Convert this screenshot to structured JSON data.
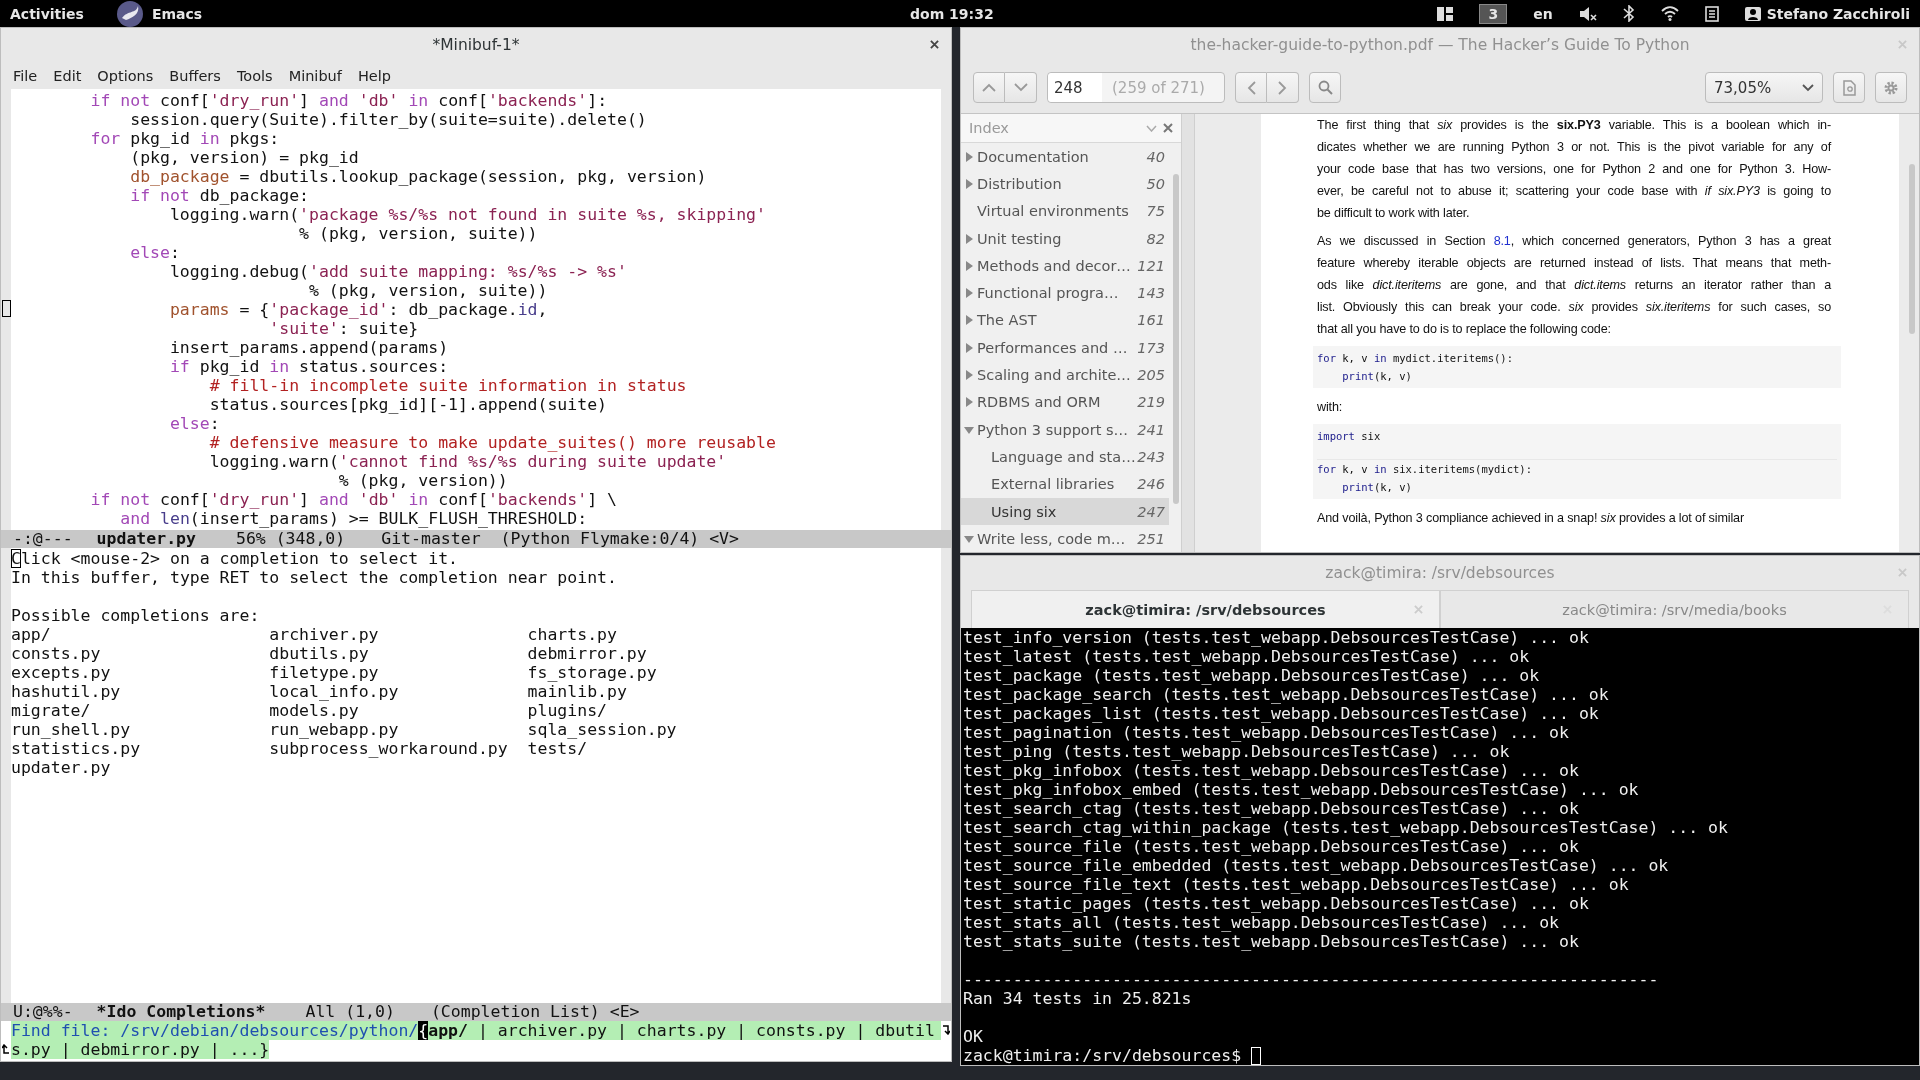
{
  "top_bar": {
    "activities": "Activities",
    "app": "Emacs",
    "clock": "dom 19:32",
    "workspace": "3",
    "keyboard": "en",
    "user": "Stefano Zacchiroli"
  },
  "emacs": {
    "title": "*Minibuf-1*",
    "menu": [
      "File",
      "Edit",
      "Options",
      "Buffers",
      "Tools",
      "Minibuf",
      "Help"
    ],
    "code_lines": [
      [
        {
          "kind": "keyword",
          "text": "        if not"
        },
        {
          "kind": "plain",
          "text": " conf["
        },
        {
          "kind": "string",
          "text": "'dry_run'"
        },
        {
          "kind": "plain",
          "text": "] "
        },
        {
          "kind": "keyword",
          "text": "and "
        },
        {
          "kind": "string",
          "text": "'db' "
        },
        {
          "kind": "keyword",
          "text": "in"
        },
        {
          "kind": "plain",
          "text": " conf["
        },
        {
          "kind": "string",
          "text": "'backends'"
        },
        {
          "kind": "plain",
          "text": "]:"
        }
      ],
      [
        {
          "kind": "plain",
          "text": "            session.query(Suite).filter_by(suite=suite).delete()"
        }
      ],
      [
        {
          "kind": "keyword",
          "text": "        for"
        },
        {
          "kind": "plain",
          "text": " pkg_id "
        },
        {
          "kind": "keyword",
          "text": "in"
        },
        {
          "kind": "plain",
          "text": " pkgs:"
        }
      ],
      [
        {
          "kind": "plain",
          "text": "            (pkg, version) = pkg_id"
        }
      ],
      [
        {
          "kind": "variable",
          "text": "            db_package"
        },
        {
          "kind": "plain",
          "text": " = dbutils.lookup_package(session, pkg, version)"
        }
      ],
      [
        {
          "kind": "keyword",
          "text": "            if not"
        },
        {
          "kind": "plain",
          "text": " db_package:"
        }
      ],
      [
        {
          "kind": "plain",
          "text": "                logging.warn("
        },
        {
          "kind": "string",
          "text": "'package %s/%s not found in suite %s, skipping'"
        }
      ],
      [
        {
          "kind": "plain",
          "text": "                             % (pkg, version, suite))"
        }
      ],
      [
        {
          "kind": "keyword",
          "text": "            else"
        },
        {
          "kind": "plain",
          "text": ":"
        }
      ],
      [
        {
          "kind": "plain",
          "text": "                logging.debug("
        },
        {
          "kind": "string",
          "text": "'add suite mapping: %s/%s -> %s'"
        }
      ],
      [
        {
          "kind": "plain",
          "text": "                              % (pkg, version, suite))"
        }
      ],
      [
        {
          "kind": "variable",
          "text": "                params"
        },
        {
          "kind": "plain",
          "text": " = {"
        },
        {
          "kind": "string",
          "text": "'package_id'"
        },
        {
          "kind": "plain",
          "text": ": db_package."
        },
        {
          "kind": "builtin",
          "text": "id"
        },
        {
          "kind": "plain",
          "text": ","
        }
      ],
      [
        {
          "kind": "string",
          "text": "                          'suite'"
        },
        {
          "kind": "plain",
          "text": ": suite}"
        }
      ],
      [
        {
          "kind": "plain",
          "text": "                insert_params.append(params)"
        }
      ],
      [
        {
          "kind": "keyword",
          "text": "                if"
        },
        {
          "kind": "plain",
          "text": " pkg_id "
        },
        {
          "kind": "keyword",
          "text": "in"
        },
        {
          "kind": "plain",
          "text": " status.sources:"
        }
      ],
      [
        {
          "kind": "comment",
          "text": "                    # fill-in incomplete suite information in status"
        }
      ],
      [
        {
          "kind": "plain",
          "text": "                    status.sources[pkg_id][-1].append(suite)"
        }
      ],
      [
        {
          "kind": "keyword",
          "text": "                else"
        },
        {
          "kind": "plain",
          "text": ":"
        }
      ],
      [
        {
          "kind": "comment",
          "text": "                    # defensive measure to make update_suites() more reusable"
        }
      ],
      [
        {
          "kind": "plain",
          "text": "                    logging.warn("
        },
        {
          "kind": "string",
          "text": "'cannot find %s/%s during suite update'"
        }
      ],
      [
        {
          "kind": "plain",
          "text": "                                 % (pkg, version))"
        }
      ],
      [
        {
          "kind": "keyword",
          "text": "        if not"
        },
        {
          "kind": "plain",
          "text": " conf["
        },
        {
          "kind": "string",
          "text": "'dry_run'"
        },
        {
          "kind": "plain",
          "text": "] "
        },
        {
          "kind": "keyword",
          "text": "and "
        },
        {
          "kind": "string",
          "text": "'db' "
        },
        {
          "kind": "keyword",
          "text": "in"
        },
        {
          "kind": "plain",
          "text": " conf["
        },
        {
          "kind": "string",
          "text": "'backends'"
        },
        {
          "kind": "plain",
          "text": "] \\"
        }
      ],
      [
        {
          "kind": "keyword",
          "text": "           and "
        },
        {
          "kind": "builtin",
          "text": "len"
        },
        {
          "kind": "plain",
          "text": "(insert_params) >= BULK_FLUSH_THRESHOLD:"
        }
      ]
    ],
    "mode_line": {
      "state": "-:@---",
      "buffer": "updater.py",
      "position": "56% (348,0)",
      "branch": "Git-master",
      "modes": "(Python Flymake:0/4) <V>"
    },
    "help_lines": [
      "Click <mouse-2> on a completion to select it.",
      "In this buffer, type RET to select the completion near point."
    ],
    "completions_heading": "Possible completions are:",
    "completions": [
      "app/",
      "archiver.py",
      "charts.py",
      "consts.py",
      "dbutils.py",
      "debmirror.py",
      "excepts.py",
      "filetype.py",
      "fs_storage.py",
      "hashutil.py",
      "local_info.py",
      "mainlib.py",
      "migrate/",
      "models.py",
      "plugins/",
      "run_shell.py",
      "run_webapp.py",
      "sqla_session.py",
      "statistics.py",
      "subprocess_workaround.py",
      "tests/",
      "updater.py"
    ],
    "completions_mode_line": {
      "state": "U:@%%-",
      "buffer": "*Ido Completions*",
      "position": "All (1,0)",
      "modes": "(Completion List) <E>"
    },
    "minibuffer": {
      "prompt": "Find file: /srv/debian/debsources/python/",
      "brace": "{",
      "current": "app/",
      "rest": " | archiver.py | charts.py | consts.py | dbutil",
      "continuation": "s.py | debmirror.py | ...}"
    }
  },
  "pdf_viewer": {
    "title": "the-hacker-guide-to-python.pdf — The Hacker’s Guide To Python",
    "page": "248",
    "page_info": "(259 of 271)",
    "zoom": "73,05%",
    "index_title": "Index",
    "index": [
      {
        "label": "Documentation",
        "page": "40",
        "expanded": false,
        "selected": false
      },
      {
        "label": "Distribution",
        "page": "50",
        "expanded": false,
        "selected": false
      },
      {
        "label": "Virtual environments",
        "page": "75",
        "selected": false
      },
      {
        "label": "Unit testing",
        "page": "82",
        "expanded": false,
        "selected": false
      },
      {
        "label": "Methods and decor…",
        "page": "121",
        "expanded": false,
        "selected": false
      },
      {
        "label": "Functional progra…",
        "page": "143",
        "expanded": false,
        "selected": false
      },
      {
        "label": "The AST",
        "page": "161",
        "expanded": false,
        "selected": false
      },
      {
        "label": "Performances and …",
        "page": "173",
        "expanded": false,
        "selected": false
      },
      {
        "label": "Scaling and archite…",
        "page": "205",
        "expanded": false,
        "selected": false
      },
      {
        "label": "RDBMS and ORM",
        "page": "219",
        "expanded": false,
        "selected": false
      },
      {
        "label": "Python 3 support s…",
        "page": "241",
        "expanded": true,
        "selected": false,
        "children": [
          {
            "label": "Language and sta…",
            "page": "243",
            "selected": false
          },
          {
            "label": "External libraries",
            "page": "246",
            "selected": false
          },
          {
            "label": "Using six",
            "page": "247",
            "selected": true
          }
        ]
      },
      {
        "label": "Write less, code m…",
        "page": "251",
        "expanded": true,
        "selected": false
      }
    ],
    "page_content": [
      {
        "kind": "paragraph",
        "lines": [
          "The first thing that *six* provides is the **six.PY3** variable. This is a boolean which in-",
          "dicates whether we are running Python 3 or not. This is the pivot variable for any of",
          "your code base that has two versions, one for Python 2 and one for Python 3. How-",
          "ever, be careful not to abuse it; scattering your code base with *if six.PY3* is going to",
          "be difficult to work with later."
        ]
      },
      {
        "kind": "paragraph",
        "lines": [
          {
            "before": "As we discussed in Section ",
            "link": "8.1",
            "after": ", which concerned generators, Python 3 has a great"
          },
          "feature whereby iterable objects are returned instead of lists. That means that meth-",
          "ods like *dict.iteritems* are gone, and that *dict.items* returns an iterator rather than a",
          "list. Obviously this can break your code. *six* provides *six.iteritems* for such cases, so",
          "that all you have to do is to replace the following code:"
        ]
      },
      {
        "kind": "code",
        "groups": [
          [
            [
              {
                "kind": "keyword",
                "text": "for"
              },
              {
                "kind": "plain",
                "text": " k, v "
              },
              {
                "kind": "keyword",
                "text": "in"
              },
              {
                "kind": "plain",
                "text": " mydict.iteritems():"
              }
            ],
            [
              {
                "kind": "keyword",
                "text": "    print"
              },
              {
                "kind": "plain",
                "text": "(k, v)"
              }
            ]
          ]
        ]
      },
      {
        "kind": "paragraph",
        "lines": [
          "with:"
        ]
      },
      {
        "kind": "code",
        "groups": [
          [
            [
              {
                "kind": "keyword",
                "text": "import"
              },
              {
                "kind": "plain",
                "text": " six"
              }
            ]
          ],
          [
            [
              {
                "kind": "keyword",
                "text": "for"
              },
              {
                "kind": "plain",
                "text": " k, v "
              },
              {
                "kind": "keyword",
                "text": "in"
              },
              {
                "kind": "plain",
                "text": " six.iteritems(mydict):"
              }
            ],
            [
              {
                "kind": "keyword",
                "text": "    print"
              },
              {
                "kind": "plain",
                "text": "(k, v)"
              }
            ]
          ]
        ]
      },
      {
        "kind": "paragraph",
        "lines": [
          "And voilà, Python 3 compliance achieved in a snap!  *six* provides a lot of similar"
        ]
      }
    ]
  },
  "terminal": {
    "title": "zack@timira: /srv/debsources",
    "tabs": [
      {
        "label": "zack@timira: /srv/debsources",
        "selected": true
      },
      {
        "label": "zack@timira: /srv/media/books",
        "selected": false
      }
    ],
    "output": [
      "test_info_version (tests.test_webapp.DebsourcesTestCase) ... ok",
      "test_latest (tests.test_webapp.DebsourcesTestCase) ... ok",
      "test_package (tests.test_webapp.DebsourcesTestCase) ... ok",
      "test_package_search (tests.test_webapp.DebsourcesTestCase) ... ok",
      "test_packages_list (tests.test_webapp.DebsourcesTestCase) ... ok",
      "test_pagination (tests.test_webapp.DebsourcesTestCase) ... ok",
      "test_ping (tests.test_webapp.DebsourcesTestCase) ... ok",
      "test_pkg_infobox (tests.test_webapp.DebsourcesTestCase) ... ok",
      "test_pkg_infobox_embed (tests.test_webapp.DebsourcesTestCase) ... ok",
      "test_search_ctag (tests.test_webapp.DebsourcesTestCase) ... ok",
      "test_search_ctag_within_package (tests.test_webapp.DebsourcesTestCase) ... ok",
      "test_source_file (tests.test_webapp.DebsourcesTestCase) ... ok",
      "test_source_file_embedded (tests.test_webapp.DebsourcesTestCase) ... ok",
      "test_source_file_text (tests.test_webapp.DebsourcesTestCase) ... ok",
      "test_static_pages (tests.test_webapp.DebsourcesTestCase) ... ok",
      "test_stats_all (tests.test_webapp.DebsourcesTestCase) ... ok",
      "test_stats_suite (tests.test_webapp.DebsourcesTestCase) ... ok"
    ],
    "separator": "----------------------------------------------------------------------",
    "summary": "Ran 34 tests in 25.821s",
    "result": "OK",
    "prompt": "zack@timira:/srv/debsources$"
  }
}
